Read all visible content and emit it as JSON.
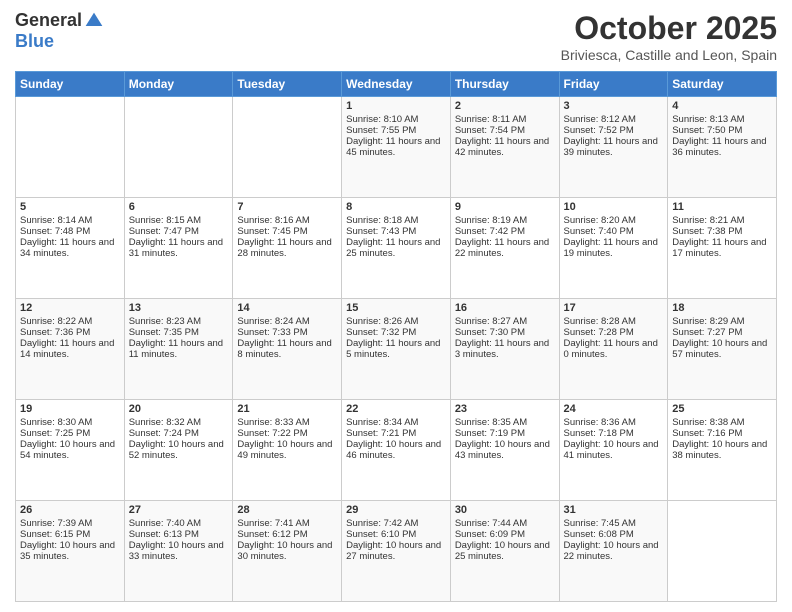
{
  "header": {
    "logo_general": "General",
    "logo_blue": "Blue",
    "month": "October 2025",
    "location": "Briviesca, Castille and Leon, Spain"
  },
  "days": [
    "Sunday",
    "Monday",
    "Tuesday",
    "Wednesday",
    "Thursday",
    "Friday",
    "Saturday"
  ],
  "weeks": [
    [
      {
        "day": "",
        "content": ""
      },
      {
        "day": "",
        "content": ""
      },
      {
        "day": "",
        "content": ""
      },
      {
        "day": "1",
        "content": "Sunrise: 8:10 AM\nSunset: 7:55 PM\nDaylight: 11 hours and 45 minutes."
      },
      {
        "day": "2",
        "content": "Sunrise: 8:11 AM\nSunset: 7:54 PM\nDaylight: 11 hours and 42 minutes."
      },
      {
        "day": "3",
        "content": "Sunrise: 8:12 AM\nSunset: 7:52 PM\nDaylight: 11 hours and 39 minutes."
      },
      {
        "day": "4",
        "content": "Sunrise: 8:13 AM\nSunset: 7:50 PM\nDaylight: 11 hours and 36 minutes."
      }
    ],
    [
      {
        "day": "5",
        "content": "Sunrise: 8:14 AM\nSunset: 7:48 PM\nDaylight: 11 hours and 34 minutes."
      },
      {
        "day": "6",
        "content": "Sunrise: 8:15 AM\nSunset: 7:47 PM\nDaylight: 11 hours and 31 minutes."
      },
      {
        "day": "7",
        "content": "Sunrise: 8:16 AM\nSunset: 7:45 PM\nDaylight: 11 hours and 28 minutes."
      },
      {
        "day": "8",
        "content": "Sunrise: 8:18 AM\nSunset: 7:43 PM\nDaylight: 11 hours and 25 minutes."
      },
      {
        "day": "9",
        "content": "Sunrise: 8:19 AM\nSunset: 7:42 PM\nDaylight: 11 hours and 22 minutes."
      },
      {
        "day": "10",
        "content": "Sunrise: 8:20 AM\nSunset: 7:40 PM\nDaylight: 11 hours and 19 minutes."
      },
      {
        "day": "11",
        "content": "Sunrise: 8:21 AM\nSunset: 7:38 PM\nDaylight: 11 hours and 17 minutes."
      }
    ],
    [
      {
        "day": "12",
        "content": "Sunrise: 8:22 AM\nSunset: 7:36 PM\nDaylight: 11 hours and 14 minutes."
      },
      {
        "day": "13",
        "content": "Sunrise: 8:23 AM\nSunset: 7:35 PM\nDaylight: 11 hours and 11 minutes."
      },
      {
        "day": "14",
        "content": "Sunrise: 8:24 AM\nSunset: 7:33 PM\nDaylight: 11 hours and 8 minutes."
      },
      {
        "day": "15",
        "content": "Sunrise: 8:26 AM\nSunset: 7:32 PM\nDaylight: 11 hours and 5 minutes."
      },
      {
        "day": "16",
        "content": "Sunrise: 8:27 AM\nSunset: 7:30 PM\nDaylight: 11 hours and 3 minutes."
      },
      {
        "day": "17",
        "content": "Sunrise: 8:28 AM\nSunset: 7:28 PM\nDaylight: 11 hours and 0 minutes."
      },
      {
        "day": "18",
        "content": "Sunrise: 8:29 AM\nSunset: 7:27 PM\nDaylight: 10 hours and 57 minutes."
      }
    ],
    [
      {
        "day": "19",
        "content": "Sunrise: 8:30 AM\nSunset: 7:25 PM\nDaylight: 10 hours and 54 minutes."
      },
      {
        "day": "20",
        "content": "Sunrise: 8:32 AM\nSunset: 7:24 PM\nDaylight: 10 hours and 52 minutes."
      },
      {
        "day": "21",
        "content": "Sunrise: 8:33 AM\nSunset: 7:22 PM\nDaylight: 10 hours and 49 minutes."
      },
      {
        "day": "22",
        "content": "Sunrise: 8:34 AM\nSunset: 7:21 PM\nDaylight: 10 hours and 46 minutes."
      },
      {
        "day": "23",
        "content": "Sunrise: 8:35 AM\nSunset: 7:19 PM\nDaylight: 10 hours and 43 minutes."
      },
      {
        "day": "24",
        "content": "Sunrise: 8:36 AM\nSunset: 7:18 PM\nDaylight: 10 hours and 41 minutes."
      },
      {
        "day": "25",
        "content": "Sunrise: 8:38 AM\nSunset: 7:16 PM\nDaylight: 10 hours and 38 minutes."
      }
    ],
    [
      {
        "day": "26",
        "content": "Sunrise: 7:39 AM\nSunset: 6:15 PM\nDaylight: 10 hours and 35 minutes."
      },
      {
        "day": "27",
        "content": "Sunrise: 7:40 AM\nSunset: 6:13 PM\nDaylight: 10 hours and 33 minutes."
      },
      {
        "day": "28",
        "content": "Sunrise: 7:41 AM\nSunset: 6:12 PM\nDaylight: 10 hours and 30 minutes."
      },
      {
        "day": "29",
        "content": "Sunrise: 7:42 AM\nSunset: 6:10 PM\nDaylight: 10 hours and 27 minutes."
      },
      {
        "day": "30",
        "content": "Sunrise: 7:44 AM\nSunset: 6:09 PM\nDaylight: 10 hours and 25 minutes."
      },
      {
        "day": "31",
        "content": "Sunrise: 7:45 AM\nSunset: 6:08 PM\nDaylight: 10 hours and 22 minutes."
      },
      {
        "day": "",
        "content": ""
      }
    ]
  ]
}
